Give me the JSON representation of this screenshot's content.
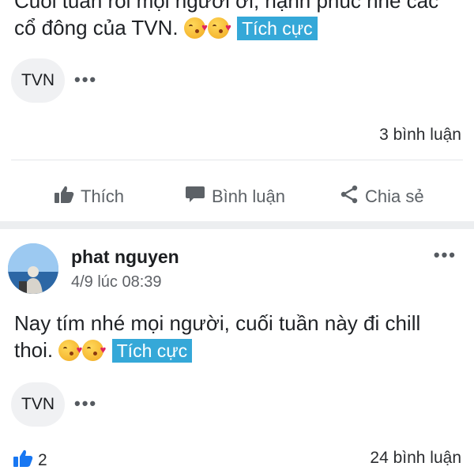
{
  "post1": {
    "text_line1": "Cuối tuần rồi mọi người ơi, hạnh phúc nhé các",
    "text_line2": "cổ đông của TVN.",
    "sentiment_badge": "Tích cực",
    "tag": "TVN",
    "more_label": "•••",
    "comment_count": "3 bình luận",
    "actions": {
      "like": "Thích",
      "comment": "Bình luận",
      "share": "Chia sẻ"
    }
  },
  "post2": {
    "author": "phat nguyen",
    "timestamp": "4/9 lúc 08:39",
    "menu_label": "•••",
    "text_line1": "Nay tím nhé mọi người, cuối tuần này đi chill",
    "text_line2": "thoi.",
    "sentiment_badge": "Tích cực",
    "tag": "TVN",
    "more_label": "•••",
    "like_count": "2",
    "comment_count": "24 bình luận"
  },
  "icons": {
    "like": "thumbs-up-icon",
    "comment": "speech-bubble-icon",
    "share": "share-icon",
    "emoji": "kissing-heart-emoji-icon"
  },
  "colors": {
    "badge": "#35a8d8",
    "like_active": "#1877f2",
    "action_text": "#5c6166"
  }
}
